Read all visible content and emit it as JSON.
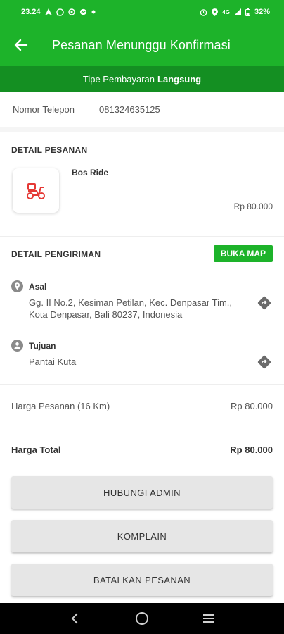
{
  "status_bar": {
    "time": "23.24",
    "network": "4G",
    "battery": "32%"
  },
  "app_bar": {
    "title": "Pesanan Menunggu Konfirmasi",
    "back_icon": "arrow-left-icon"
  },
  "payment_banner": {
    "prefix": "Tipe Pembayaran",
    "type": "Langsung"
  },
  "phone": {
    "label": "Nomor Telepon",
    "value": "081324635125"
  },
  "order_detail": {
    "title": "DETAIL PESANAN",
    "product_name": "Bos Ride",
    "product_price": "Rp 80.000",
    "product_icon": "scooter-icon"
  },
  "delivery_detail": {
    "title": "DETAIL PENGIRIMAN",
    "map_button": "BUKA MAP",
    "origin": {
      "label": "Asal",
      "line1": "Gg. II No.2, Kesiman Petilan, Kec. Denpasar Tim.,",
      "line2": "Kota Denpasar, Bali 80237, Indonesia"
    },
    "destination": {
      "label": "Tujuan",
      "address": "Pantai Kuta"
    }
  },
  "pricing": {
    "order_label": "Harga Pesanan (16 Km)",
    "order_value": "Rp 80.000",
    "total_label": "Harga Total",
    "total_value": "Rp 80.000"
  },
  "actions": {
    "contact_admin": "HUBUNGI ADMIN",
    "complain": "KOMPLAIN",
    "cancel": "BATALKAN PESANAN"
  },
  "colors": {
    "primary": "#1db32a",
    "primary_dark": "#148f22",
    "accent_red": "#e53935"
  }
}
